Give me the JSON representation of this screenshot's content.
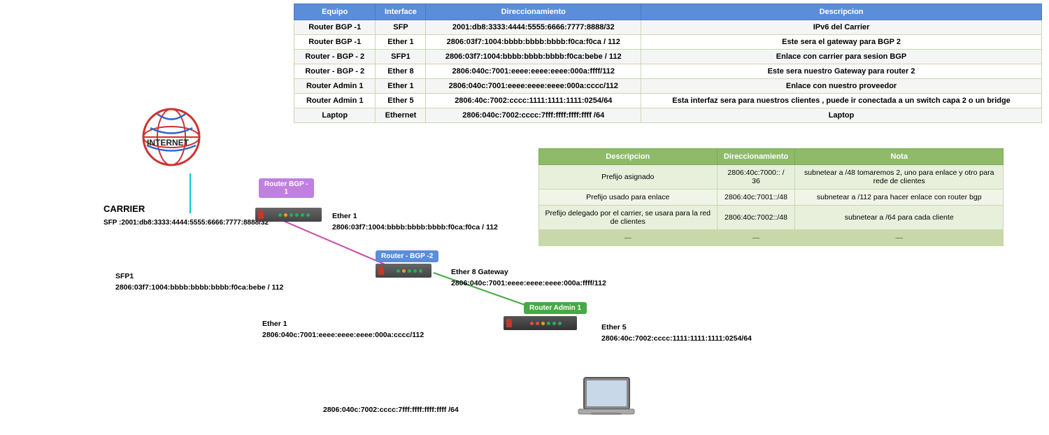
{
  "table": {
    "headers": [
      "Equipo",
      "Interface",
      "Direccionamiento",
      "Descripcion"
    ],
    "rows": [
      {
        "equipo": "Router BGP -1",
        "interface": "SFP",
        "direccionamiento": "2001:db8:3333:4444:5555:6666:7777:8888/32",
        "descripcion": "IPv6 del Carrier"
      },
      {
        "equipo": "Router BGP -1",
        "interface": "Ether 1",
        "direccionamiento": "2806:03f7:1004:bbbb:bbbb:bbbb:f0ca:f0ca / 112",
        "descripcion": "Este sera el gateway para BGP 2"
      },
      {
        "equipo": "Router - BGP - 2",
        "interface": "SFP1",
        "direccionamiento": "2806:03f7:1004:bbbb:bbbb:bbbb:f0ca:bebe / 112",
        "descripcion": "Enlace con carrier para sesion BGP"
      },
      {
        "equipo": "Router - BGP - 2",
        "interface": "Ether 8",
        "direccionamiento": "2806:040c:7001:eeee:eeee:eeee:000a:ffff/112",
        "descripcion": "Este sera nuestro Gateway para router 2"
      },
      {
        "equipo": "Router Admin 1",
        "interface": "Ether 1",
        "direccionamiento": "2806:040c:7001:eeee:eeee:eeee:000a:cccc/112",
        "descripcion": "Enlace con nuestro proveedor"
      },
      {
        "equipo": "Router Admin 1",
        "interface": "Ether 5",
        "direccionamiento": "2806:40c:7002:cccc:1111:1111:1111:0254/64",
        "descripcion": "Esta interfaz sera para nuestros clientes , puede ir conectada a un switch capa 2 o un bridge"
      },
      {
        "equipo": "Laptop",
        "interface": "Ethernet",
        "direccionamiento": "2806:040c:7002:cccc:7fff:ffff:ffff:ffff /64",
        "descripcion": "Laptop"
      }
    ]
  },
  "second_table": {
    "headers": [
      "Descripcion",
      "Direccionamiento",
      "Nota"
    ],
    "rows": [
      {
        "descripcion": "Prefijo asignado",
        "direccionamiento": "2806:40c:7000:: / 36",
        "nota": "subnetear a /48  tomaremos 2, uno para enlace y otro para rede de clientes"
      },
      {
        "descripcion": "Prefijo usado para enlace",
        "direccionamiento": "2806:40c:7001::/48",
        "nota": "subnetear a /112 para hacer enlace con router bgp"
      },
      {
        "descripcion": "Prefijo delegado por el carrier, se usara para la red de clientes",
        "direccionamiento": "2806:40c:7002::/48",
        "nota": "subnetear a /64 para cada cliente"
      },
      {
        "descripcion": "—",
        "direccionamiento": "—",
        "nota": "—"
      }
    ]
  },
  "diagram": {
    "internet_label": "INTERNET",
    "carrier_label": "CARRIER",
    "carrier_sfp": "SFP :2001:db8:3333:4444:5555:6666:7777:8888/32",
    "router_bgp1_label": "Router BGP -\n1",
    "router_bgp2_label": "Router - BGP -2",
    "router_admin1_label": "Router Admin 1",
    "ether1_label": "Ether 1",
    "ether1_addr": "2806:03f7:1004:bbbb:bbbb:bbbb:f0ca:f0ca / 112",
    "sfp1_label": "SFP1",
    "sfp1_addr": "2806:03f7:1004:bbbb:bbbb:bbbb:f0ca:bebe / 112",
    "ether8_label": "Ether 8 Gateway",
    "ether8_addr": "2806:040c:7001:eeee:eeee:eeee:000a:ffff/112",
    "ether1_admin_label": "Ether 1",
    "ether1_admin_addr": "2806:040c:7001:eeee:eeee:eeee:000a:cccc/112",
    "ether5_label": "Ether 5",
    "ether5_addr": "2806:40c:7002:cccc:1111:1111:1111:0254/64",
    "laptop_addr": "2806:040c:7002:cccc:7fff:ffff:ffff:ffff /64"
  }
}
